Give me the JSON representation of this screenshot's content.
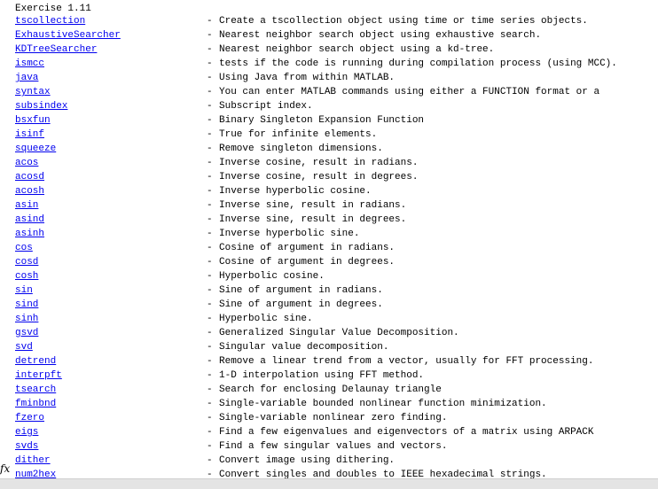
{
  "console": {
    "heading": "Exercise 1.11",
    "separator": "-",
    "rows": [
      {
        "name": "tscollection",
        "desc": "Create a tscollection object using time or time series objects."
      },
      {
        "name": "ExhaustiveSearcher",
        "desc": "Nearest neighbor search object using exhaustive search."
      },
      {
        "name": "KDTreeSearcher",
        "desc": "Nearest neighbor search object using a kd-tree."
      },
      {
        "name": "ismcc",
        "desc": "tests if the code is running during compilation process (using MCC)."
      },
      {
        "name": "java",
        "desc": "Using Java from within MATLAB."
      },
      {
        "name": "syntax",
        "desc": "You can enter MATLAB commands using either a FUNCTION format or a"
      },
      {
        "name": "subsindex",
        "desc": "Subscript index."
      },
      {
        "name": "bsxfun",
        "desc": "Binary Singleton Expansion Function"
      },
      {
        "name": "isinf",
        "desc": "True for infinite elements."
      },
      {
        "name": "squeeze",
        "desc": "Remove singleton dimensions."
      },
      {
        "name": "acos",
        "desc": "Inverse cosine, result in radians."
      },
      {
        "name": "acosd",
        "desc": "Inverse cosine, result in degrees."
      },
      {
        "name": "acosh",
        "desc": "Inverse hyperbolic cosine."
      },
      {
        "name": "asin",
        "desc": "Inverse sine, result in radians."
      },
      {
        "name": "asind",
        "desc": "Inverse sine, result in degrees."
      },
      {
        "name": "asinh",
        "desc": "Inverse hyperbolic sine."
      },
      {
        "name": "cos",
        "desc": "Cosine of argument in radians."
      },
      {
        "name": "cosd",
        "desc": "Cosine of argument in degrees."
      },
      {
        "name": "cosh",
        "desc": "Hyperbolic cosine."
      },
      {
        "name": "sin",
        "desc": "Sine of argument in radians."
      },
      {
        "name": "sind",
        "desc": "Sine of argument in degrees."
      },
      {
        "name": "sinh",
        "desc": "Hyperbolic sine."
      },
      {
        "name": "gsvd",
        "desc": "Generalized Singular Value Decomposition."
      },
      {
        "name": "svd",
        "desc": "Singular value decomposition."
      },
      {
        "name": "detrend",
        "desc": "Remove a linear trend from a vector, usually for FFT processing."
      },
      {
        "name": "interpft",
        "desc": "1-D interpolation using FFT method."
      },
      {
        "name": "tsearch",
        "desc": "Search for enclosing Delaunay triangle"
      },
      {
        "name": "fminbnd",
        "desc": "Single-variable bounded nonlinear function minimization."
      },
      {
        "name": "fzero",
        "desc": "Single-variable nonlinear zero finding."
      },
      {
        "name": "eigs",
        "desc": "Find a few eigenvalues and eigenvectors of a matrix using ARPACK"
      },
      {
        "name": "svds",
        "desc": "Find a few singular values and vectors."
      },
      {
        "name": "dither",
        "desc": "Convert image using dithering."
      },
      {
        "name": "num2hex",
        "desc": "Convert singles and doubles to IEEE hexadecimal strings."
      }
    ],
    "prompt_icon": "fx-icon",
    "prompt_glyph": "fx"
  }
}
